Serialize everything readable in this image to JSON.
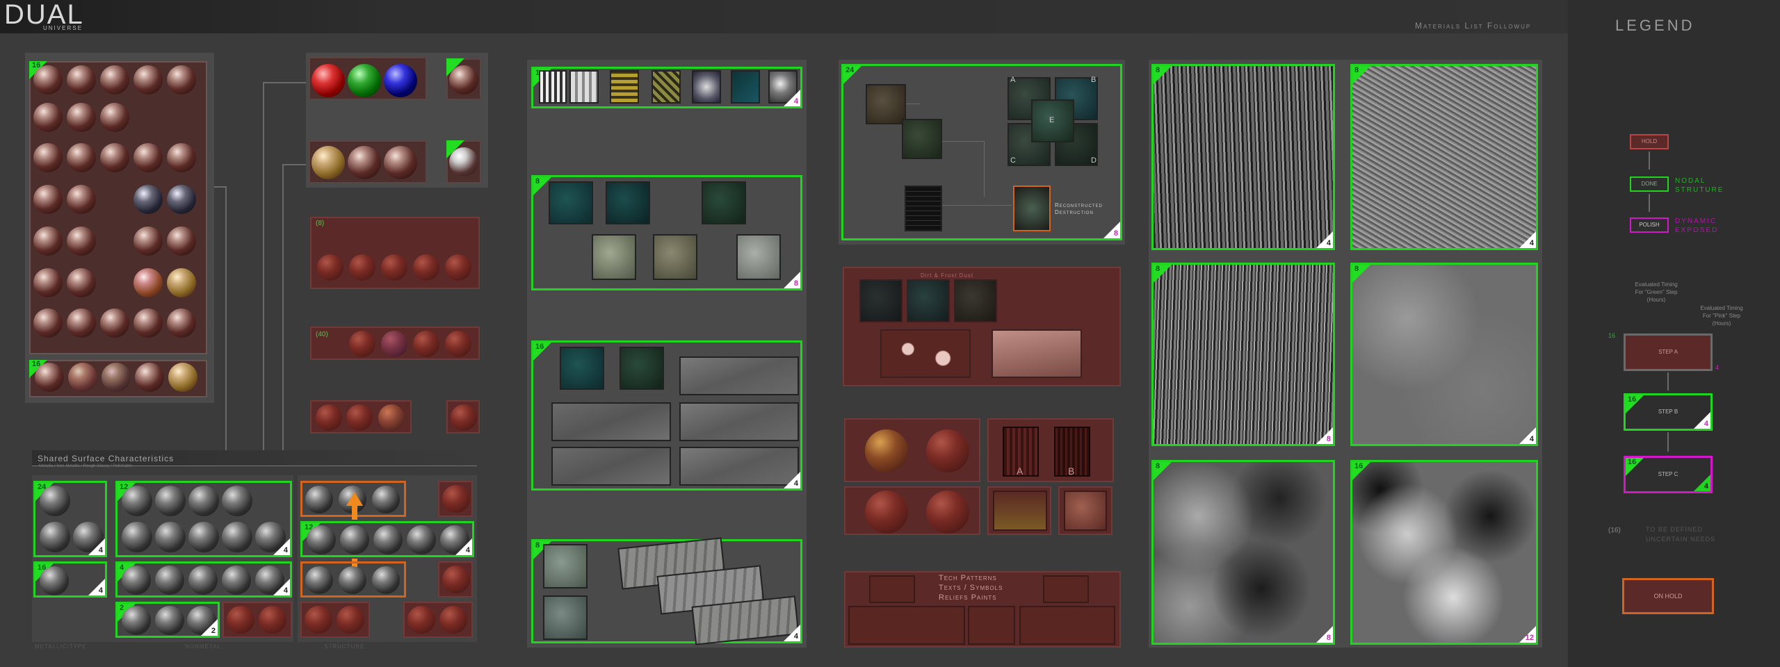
{
  "header": {
    "logo_main": "DUAL",
    "logo_sub": "UNIVERSE",
    "title": "Materials List Followup"
  },
  "legend": {
    "title": "LEGEND",
    "hold_label": "HOLD",
    "done_label": "DONE",
    "nodal_label_1": "NODAL",
    "nodal_label_2": "STRUTURE",
    "polish_label": "POLISH",
    "dynamic_label_1": "DYNAMIC",
    "dynamic_label_2": "EXPOSED",
    "green_timing": [
      "Evaluated Timing",
      "For \"Green\" Step",
      "(Hours)"
    ],
    "pink_timing": [
      "Evaluated Timing",
      "For \"Pink\" Step",
      "(Hours)"
    ],
    "step_a": "STEP A",
    "step_b": "STEP B",
    "step_c": "STEP C",
    "step_a_num": "16",
    "step_a_pink": "4",
    "step_b_num": "16",
    "step_b_badge": "4",
    "step_c_num": "16",
    "step_c_badge": "4",
    "tbd_num": "(16)",
    "tbd_text_1": "TO BE DEFINED",
    "tbd_text_2": "UNCERTAIN NEEDS",
    "onhold_label": "ON HOLD"
  },
  "col1": {
    "main_num": "16",
    "bottom_num": "16",
    "shared_title": "Shared Surface Characteristics",
    "shared_sub": "Metallic / Non-Metallic / Rough Glossy / Polishable",
    "footer_labels": [
      "METALLIC/TYPE",
      "NONMETAL",
      "STRUCTURE"
    ],
    "g1_num": "24",
    "g1_badge": "4",
    "g2_num": "16",
    "g2_badge": "4",
    "g3_num": "12",
    "g3_badge": "4",
    "g4_num": "4",
    "g4_badge": "4",
    "g5_num": "2",
    "g5_badge": "2",
    "g6_num": "12",
    "g6_badge": "4",
    "colored_num": "(8)",
    "colored_num2": "(40)"
  },
  "col3": {
    "b1_num": "1",
    "b1_badge": "4",
    "b2_num": "8",
    "b2_badge": "8",
    "b3_num": "16",
    "b3_badge": "4",
    "b4_num": "8",
    "b4_badge": "4"
  },
  "col4": {
    "b1_num": "24",
    "b1_badge": "8",
    "quad_labels": [
      "A",
      "B",
      "C",
      "D",
      "E"
    ],
    "reconstructed": [
      "Reconstructed",
      "Destruction"
    ],
    "maroon_title": "Dirt & Frost Dust",
    "tech_lines": [
      "Tech Patterns",
      "Texts / Symbols",
      "Reliefs Paints"
    ],
    "ab_labels": [
      "A",
      "B"
    ]
  },
  "col5": {
    "tiles": [
      {
        "num": "8",
        "badge": "4",
        "pink": false
      },
      {
        "num": "8",
        "badge": "4",
        "pink": false
      },
      {
        "num": "8",
        "badge": "8",
        "pink": true
      },
      {
        "num": "8",
        "badge": "4",
        "pink": false
      },
      {
        "num": "8",
        "badge": "8",
        "pink": true
      },
      {
        "num": "16",
        "badge": "12",
        "pink": true
      }
    ]
  }
}
